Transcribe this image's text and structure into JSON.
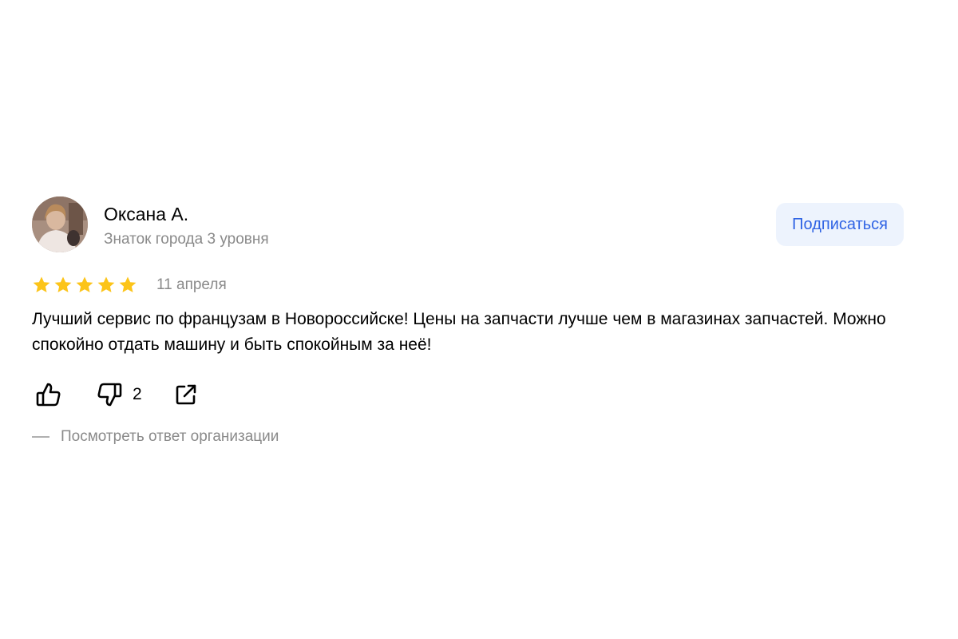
{
  "author": {
    "name": "Оксана А.",
    "level": "Знаток города 3 уровня"
  },
  "subscribe": {
    "label": "Подписаться"
  },
  "review": {
    "rating": 5,
    "rating_max": 5,
    "date": "11 апреля",
    "text": "Лучший сервис по французам в Новороссийске! Цены на запчасти лучше чем в магазинах запчастей. Можно спокойно отдать машину и быть спокойным за неё!"
  },
  "reactions": {
    "likes_count": "",
    "dislikes_count": "2",
    "like_icon": "thumbs-up-icon",
    "dislike_icon": "thumbs-down-icon",
    "share_icon": "share-icon"
  },
  "org_response": {
    "label": "Посмотреть ответ организации"
  },
  "colors": {
    "star": "#fcc419",
    "accent": "#2f63e4",
    "subscribe_bg": "#edf3fd",
    "muted_text": "#8a8a8a"
  }
}
